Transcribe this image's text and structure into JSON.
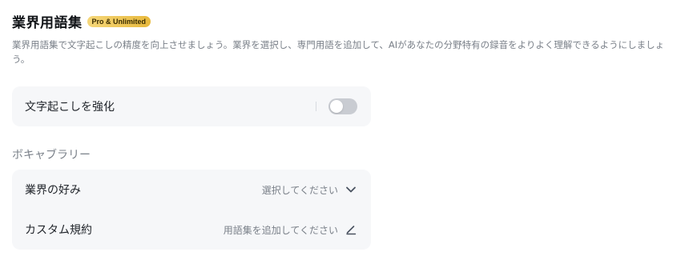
{
  "header": {
    "title": "業界用語集",
    "badge": "Pro & Unlimited",
    "description": "業界用語集で文字起こしの精度を向上させましょう。業界を選択し、専門用語を追加して、AIがあなたの分野特有の録音をよりよく理解できるようにしましょう。"
  },
  "enhance": {
    "label": "文字起こしを強化",
    "enabled": false
  },
  "vocabulary": {
    "section_label": "ボキャブラリー",
    "rows": [
      {
        "label": "業界の好み",
        "value": "選択してください",
        "icon": "chevron-down-icon"
      },
      {
        "label": "カスタム規約",
        "value": "用語集を追加してください",
        "icon": "edit-icon"
      }
    ]
  },
  "colors": {
    "badge_gradient_start": "#f5d77a",
    "badge_gradient_end": "#e8b93c",
    "card_background": "#f6f7f9",
    "toggle_off": "#c9ccd2",
    "muted_text": "#7a8089"
  }
}
